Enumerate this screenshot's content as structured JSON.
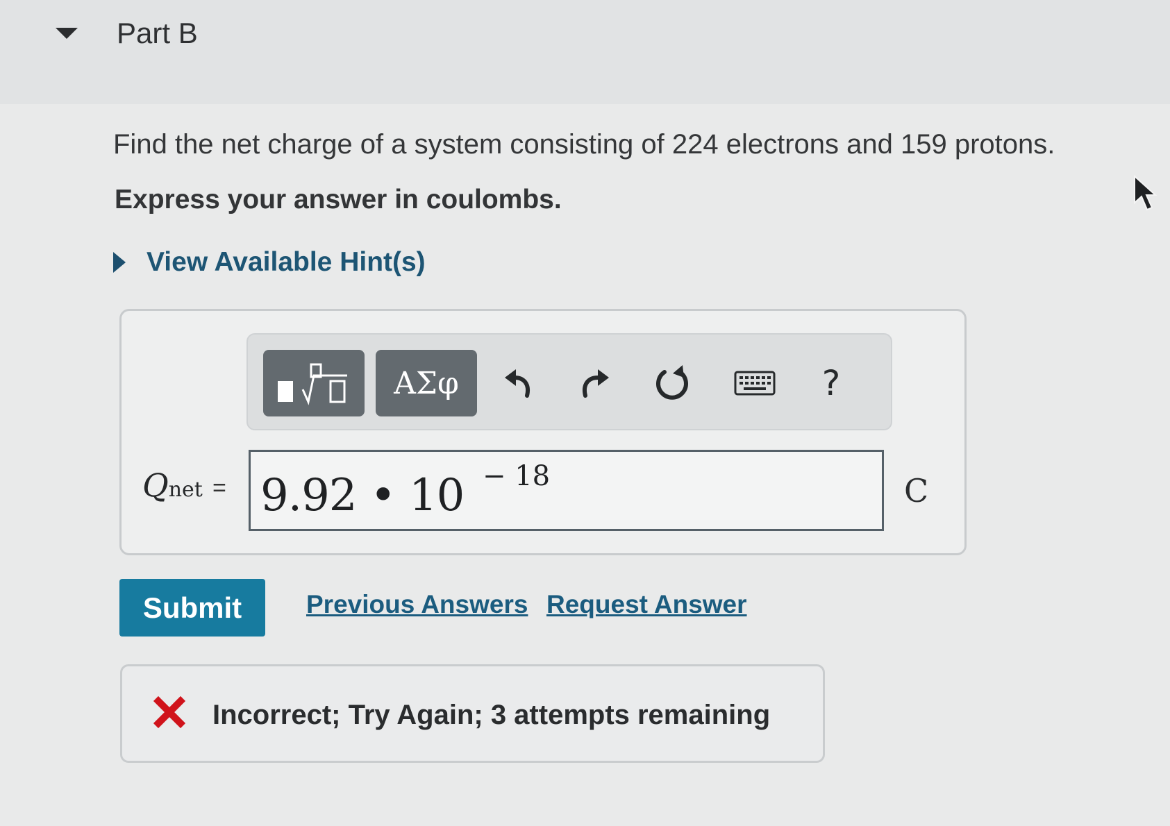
{
  "part": {
    "title": "Part B"
  },
  "problem": {
    "question": "Find the net charge of a system consisting of 224 electrons and 159 protons.",
    "instruction": "Express your answer in coulombs."
  },
  "hints": {
    "label": "View Available Hint(s)"
  },
  "toolbar": {
    "symbols_label": "ΑΣφ",
    "help_label": "?"
  },
  "answer": {
    "variable": "Q",
    "subscript": "net",
    "equals": "=",
    "value_mantissa": "9.92 • 10",
    "value_exponent": "− 18",
    "unit": "C"
  },
  "actions": {
    "submit_label": "Submit",
    "previous_answers_label": "Previous Answers",
    "request_answer_label": "Request Answer"
  },
  "feedback": {
    "message": "Incorrect; Try Again; 3 attempts remaining",
    "icon_color": "#d0131b"
  },
  "colors": {
    "accent": "#177b9f",
    "link": "#1b5c7f",
    "toolbar_button": "#636a6f"
  },
  "icons": {
    "templates": "fraction-root-template-icon",
    "undo": "undo-icon",
    "redo": "redo-icon",
    "reset": "reset-icon",
    "keyboard": "keyboard-icon",
    "help": "help-icon",
    "feedback": "incorrect-x-icon"
  }
}
